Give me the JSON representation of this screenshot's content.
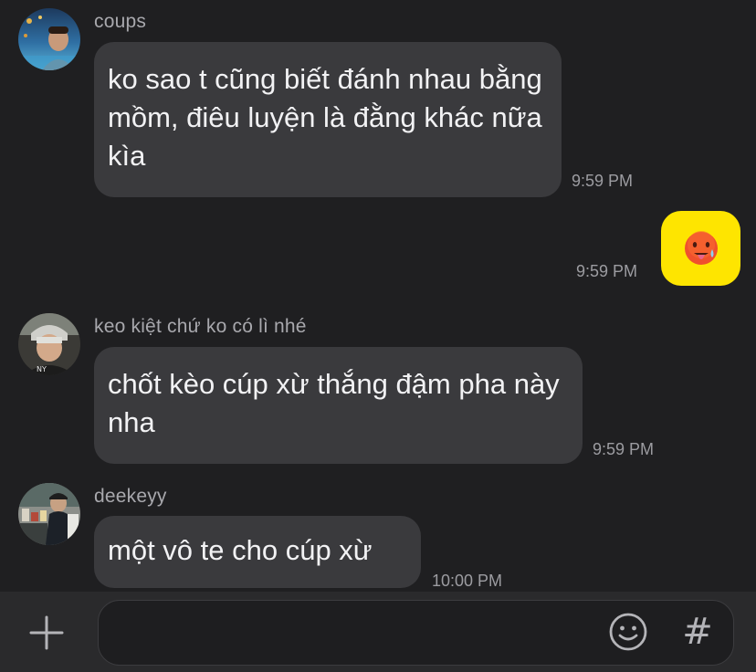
{
  "messages": [
    {
      "sender": "coups",
      "text": "ko sao t cũng biết đánh nhau bằng mồm, điêu luyện là đằng khác nữa kìa",
      "time": "9:59 PM"
    },
    {
      "sender": "me",
      "sticker": "hot-face-emoji",
      "time": "9:59 PM"
    },
    {
      "sender": "keo kiệt chứ ko có lì nhé",
      "text": "chốt kèo cúp xừ thắng đậm pha này nha",
      "time": "9:59 PM"
    },
    {
      "sender": "deekeyy",
      "text": "một vô te cho cúp xừ",
      "time": "10:00 PM"
    }
  ],
  "input_bar": {
    "plus_icon": "plus-icon",
    "emoji_icon": "smiley-icon",
    "hash_label": "#"
  },
  "colors": {
    "background": "#1f1f21",
    "bubble_incoming": "#3a3a3d",
    "bubble_outgoing": "#fee500",
    "text": "#f2f2f4",
    "meta": "#9c9ca1"
  }
}
